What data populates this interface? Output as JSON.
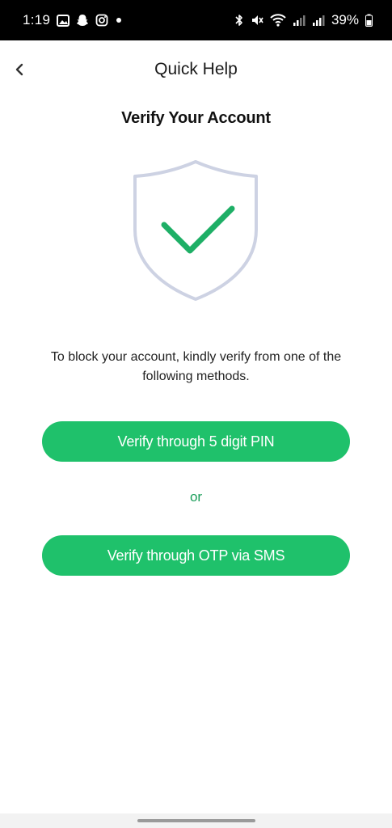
{
  "status_bar": {
    "time": "1:19",
    "battery": "39%",
    "icons": [
      "gallery-icon",
      "snapchat-icon",
      "instagram-icon",
      "notification-dot-icon",
      "bluetooth-icon",
      "mute-icon",
      "wifi-icon",
      "signal-icon",
      "signal-icon-2",
      "battery-icon"
    ]
  },
  "header": {
    "title": "Quick Help",
    "back_icon": "chevron-left-icon"
  },
  "main": {
    "section_title": "Verify Your Account",
    "illustration_icon": "shield-check-icon",
    "description": "To block your account, kindly verify from one of the following methods.",
    "button_pin": "Verify through 5 digit PIN",
    "separator": "or",
    "button_otp": "Verify through OTP via SMS"
  },
  "colors": {
    "accent": "#1fc16b",
    "separator_text": "#1b9e5a",
    "shield_outline": "#cdd2e3",
    "check": "#1eaf66"
  }
}
